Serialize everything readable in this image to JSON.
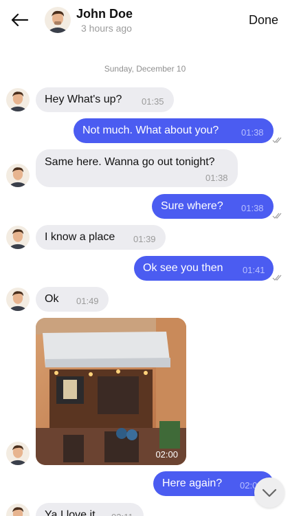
{
  "header": {
    "contact_name": "John Doe",
    "status": "3 hours ago",
    "done_label": "Done",
    "back_icon": "arrow-left-icon"
  },
  "date_separator": "Sunday, December 10",
  "messages": [
    {
      "dir": "in",
      "text": "Hey What's up?",
      "time": "01:35"
    },
    {
      "dir": "out",
      "text": "Not much. What about you?",
      "time": "01:38"
    },
    {
      "dir": "in",
      "text": "Same here. Wanna go out tonight?",
      "time": "01:38"
    },
    {
      "dir": "out",
      "text": "Sure where?",
      "time": "01:38"
    },
    {
      "dir": "in",
      "text": "I know a place",
      "time": "01:39"
    },
    {
      "dir": "out",
      "text": "Ok see you then",
      "time": "01:41"
    },
    {
      "dir": "in",
      "text": "Ok",
      "time": "01:49"
    },
    {
      "dir": "in",
      "type": "photo",
      "time": "02:00"
    },
    {
      "dir": "out",
      "text": "Here again?",
      "time": "02:0"
    },
    {
      "dir": "in",
      "text": "Ya I love it",
      "time": "02:11"
    }
  ],
  "colors": {
    "outgoing_bubble": "#4b5cf1",
    "incoming_bubble": "#ececf0"
  }
}
